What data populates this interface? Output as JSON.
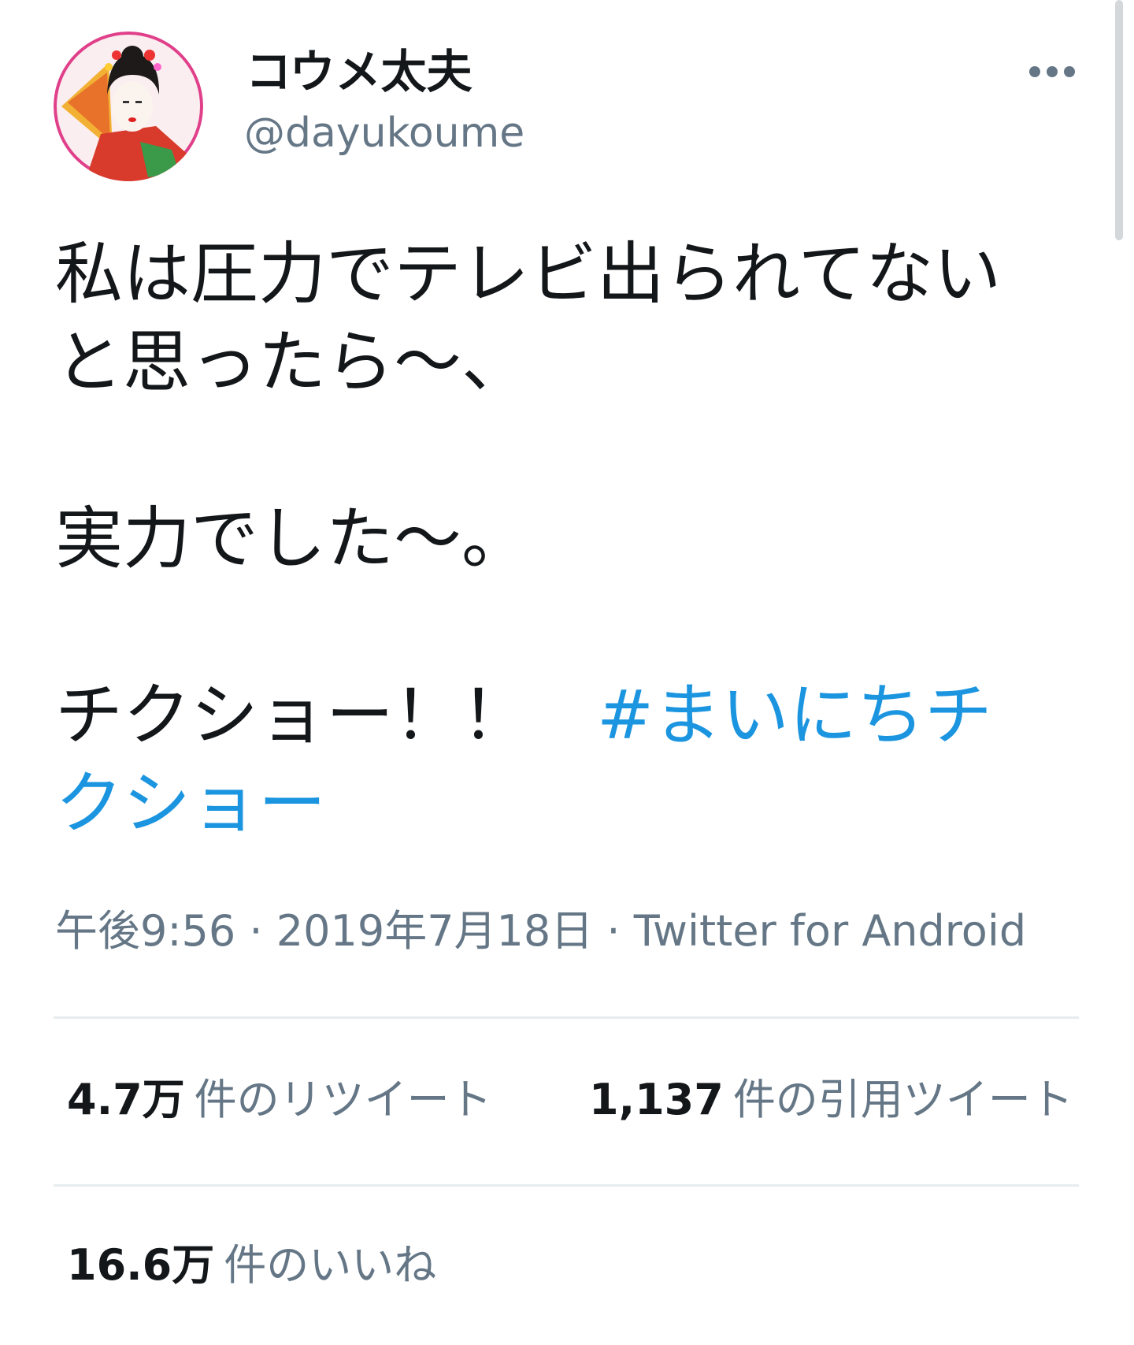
{
  "user": {
    "display_name": "コウメ太夫",
    "handle": "@dayukoume"
  },
  "header": {
    "more_icon": "more-horizontal-icon"
  },
  "tweet": {
    "lines": [
      "私は圧力でテレビ出られてない",
      "と思ったら〜、",
      "実力でした〜。",
      "チクショー！！　"
    ],
    "hashtag_line1": "#まいにちチ",
    "hashtag_line2": "クショー"
  },
  "meta": {
    "time": "午後9:56",
    "separator1": " · ",
    "date": "2019年7月18日",
    "separator2": " · ",
    "source": "Twitter for Android"
  },
  "stats": {
    "retweets_count": "4.7万",
    "retweets_label": "件のリツイート",
    "quotes_count": "1,137",
    "quotes_label": "件の引用ツイート",
    "likes_count": "16.6万",
    "likes_label": "件のいいね"
  },
  "colors": {
    "text": "#14171a",
    "secondary": "#657786",
    "link": "#1b95e0",
    "divider": "#e6ecf0"
  }
}
